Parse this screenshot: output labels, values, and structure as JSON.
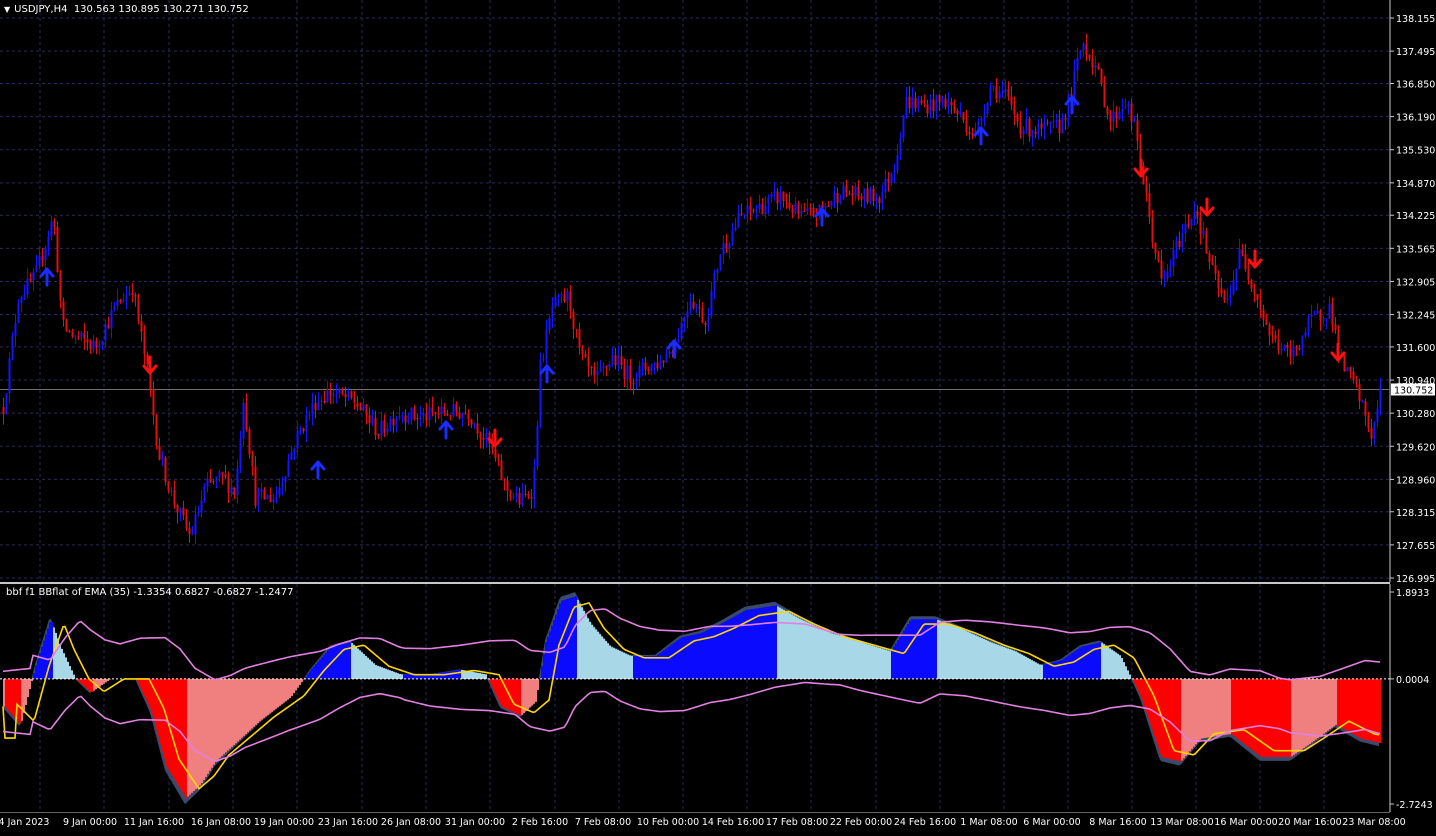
{
  "main": {
    "symbol_label": "USDJPY,H4",
    "ohlc": "130.563 130.895 130.271 130.752",
    "current_price": "130.752",
    "price_ticks": [
      "138.155",
      "137.495",
      "136.850",
      "136.190",
      "135.530",
      "134.870",
      "134.225",
      "133.565",
      "132.905",
      "132.245",
      "131.600",
      "130.940",
      "130.280",
      "129.620",
      "128.960",
      "128.315",
      "127.655",
      "126.995"
    ],
    "price_range": [
      126.995,
      138.155
    ]
  },
  "indicator": {
    "label": "bbf f1 BBflat of EMA (35) -1.3354 0.6827 -0.6827 -1.2477",
    "ticks": [
      "1.8933",
      "0.0004",
      "-2.7243"
    ],
    "range": [
      -2.7243,
      1.8933
    ]
  },
  "time_axis": {
    "labels": [
      "4 Jan 2023",
      "9 Jan 00:00",
      "11 Jan 16:00",
      "16 Jan 08:00",
      "19 Jan 00:00",
      "23 Jan 16:00",
      "26 Jan 08:00",
      "31 Jan 00:00",
      "2 Feb 16:00",
      "7 Feb 08:00",
      "10 Feb 00:00",
      "14 Feb 16:00",
      "17 Feb 08:00",
      "22 Feb 00:00",
      "24 Feb 16:00",
      "1 Mar 08:00",
      "6 Mar 00:00",
      "8 Mar 16:00",
      "13 Mar 08:00",
      "16 Mar 00:00",
      "20 Mar 16:00",
      "23 Mar 08:00"
    ]
  },
  "colors": {
    "background": "#000000",
    "grid": "#2a2a5a",
    "bull_candle": "#1515ff",
    "bear_candle": "#e01010",
    "up_arrow": "#1a2cff",
    "down_arrow": "#ff1010",
    "hist_blue": "#0a0aff",
    "hist_lightblue": "#a8d8e8",
    "hist_red": "#ff0000",
    "hist_pink": "#f08080",
    "signal_yellow": "#ffd700",
    "band_violet": "#e080e0"
  },
  "icons": {
    "up_signal": "arrow-up-icon",
    "down_signal": "arrow-down-icon"
  }
}
